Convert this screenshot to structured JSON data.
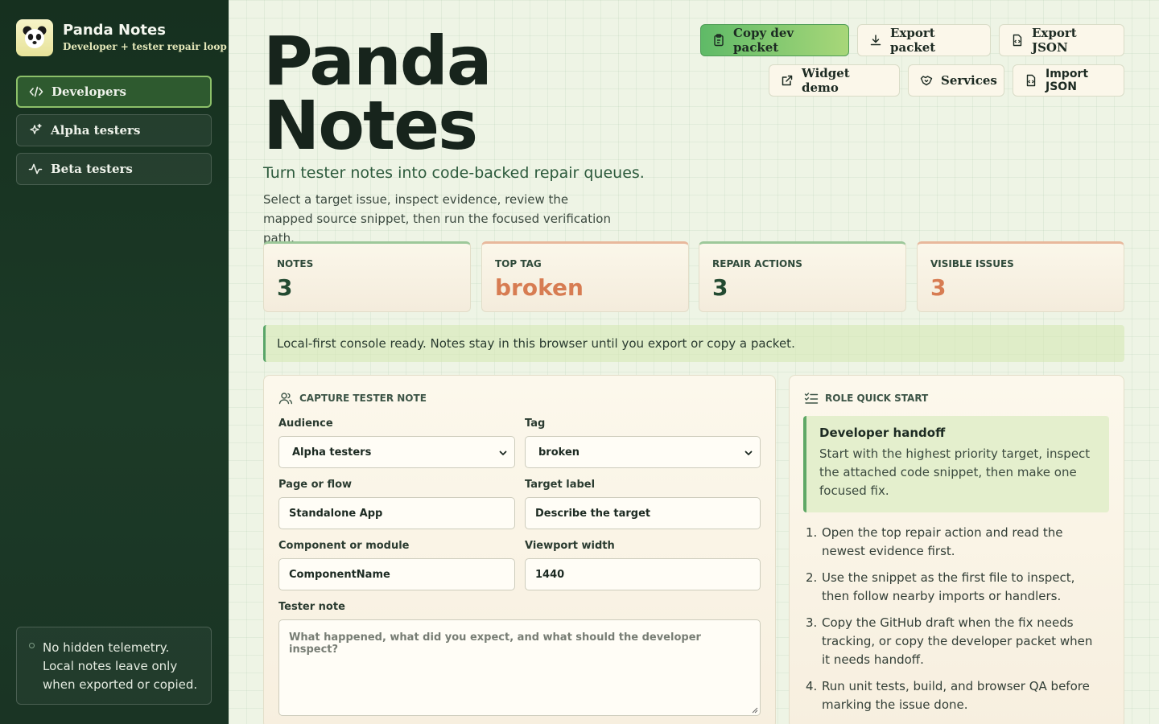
{
  "brand": {
    "title": "Panda Notes",
    "subtitle": "Developer + tester repair loop"
  },
  "sidebar": {
    "items": [
      {
        "label": "Developers",
        "icon": "code-icon",
        "active": true
      },
      {
        "label": "Alpha testers",
        "icon": "sparkles-icon",
        "active": false
      },
      {
        "label": "Beta testers",
        "icon": "activity-icon",
        "active": false
      }
    ],
    "note": "No hidden telemetry. Local notes leave only when exported or copied."
  },
  "header": {
    "title_line1": "Panda",
    "title_line2": "Notes",
    "subtitle": "Turn tester notes into code-backed repair queues.",
    "description": "Select a target issue, inspect evidence, review the mapped source snippet, then run the focused verification path."
  },
  "toolbar": {
    "copy_dev_packet": "Copy dev packet",
    "export_packet": "Export packet",
    "export_json": "Export JSON",
    "widget_demo": "Widget demo",
    "services": "Services",
    "import_json": "Import JSON"
  },
  "stats": [
    {
      "label": "NOTES",
      "value": "3"
    },
    {
      "label": "TOP TAG",
      "value": "broken"
    },
    {
      "label": "REPAIR ACTIONS",
      "value": "3"
    },
    {
      "label": "VISIBLE ISSUES",
      "value": "3"
    }
  ],
  "banner": "Local-first console ready. Notes stay in this browser until you export or copy a packet.",
  "capture": {
    "title": "CAPTURE TESTER NOTE",
    "audience_label": "Audience",
    "audience_value": "Alpha testers",
    "tag_label": "Tag",
    "tag_value": "broken",
    "page_label": "Page or flow",
    "page_value": "Standalone App",
    "target_label": "Target label",
    "target_value": "Describe the target",
    "component_label": "Component or module",
    "component_value": "ComponentName",
    "viewport_label": "Viewport width",
    "viewport_value": "1440",
    "note_label": "Tester note",
    "note_placeholder": "What happened, what did you expect, and what should the developer inspect?"
  },
  "quickstart": {
    "title": "ROLE QUICK START",
    "handoff_title": "Developer handoff",
    "handoff_text": "Start with the highest priority target, inspect the attached code snippet, then make one focused fix.",
    "steps": [
      "Open the top repair action and read the newest evidence first.",
      "Use the snippet as the first file to inspect, then follow nearby imports or handlers.",
      "Copy the GitHub draft when the fix needs tracking, or copy the developer packet when it needs handoff.",
      "Run unit tests, build, and browser QA before marking the issue done."
    ]
  },
  "colors": {
    "sidebar_bg": "#16301f",
    "accent_green": "#5fba67",
    "accent_orange": "#d77c52"
  }
}
